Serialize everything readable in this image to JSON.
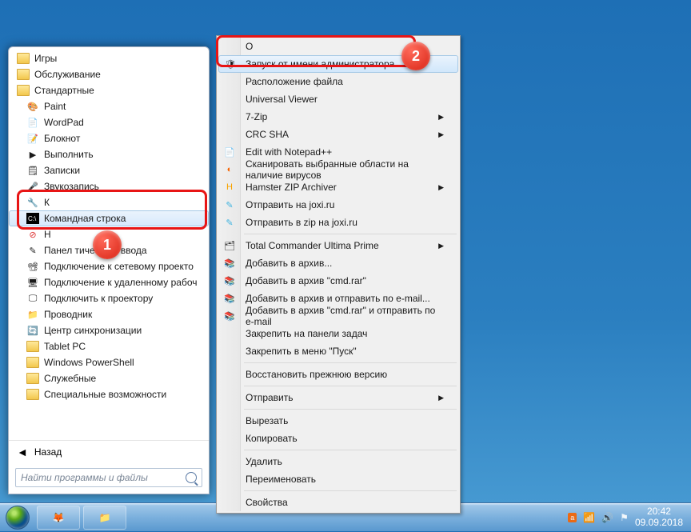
{
  "start_menu": {
    "folders_top": [
      "Игры",
      "Обслуживание",
      "Стандартные"
    ],
    "programs": {
      "paint": "Paint",
      "wordpad": "WordPad",
      "notepad": "Блокнот",
      "run": "Выполнить",
      "notes": "Записки",
      "soundrec": "Звукозапись",
      "cmd_truncated_1": "К",
      "cmd": "Командная строка",
      "cmd_truncated_2": "Н",
      "tablet_input": "Панел           тического ввода",
      "connect_netproj": "Подключение к сетевому проекто",
      "connect_remote": "Подключение к удаленному рабоч",
      "connect_proj": "Подключить к проектору",
      "explorer": "Проводник",
      "sync": "Центр синхронизации"
    },
    "folders_bottom": [
      "Tablet PC",
      "Windows PowerShell",
      "Служебные",
      "Специальные возможности"
    ],
    "back": "Назад",
    "search_placeholder": "Найти программы и файлы"
  },
  "context_menu": {
    "open_truncated": "О",
    "run_as_admin": "Запуск от имени администратора",
    "file_location": "Расположение файла",
    "universal_viewer": "Universal Viewer",
    "seven_zip": "7-Zip",
    "crc_sha": "CRC SHA",
    "notepadpp": "Edit with Notepad++",
    "scan_virus": "Сканировать выбранные области на наличие вирусов",
    "hamster": "Hamster ZIP Archiver",
    "joxi": "Отправить на joxi.ru",
    "joxi_zip": "Отправить в zip на joxi.ru",
    "total_cmd": "Total Commander Ultima Prime",
    "add_archive": "Добавить в архив...",
    "add_cmd_rar": "Добавить в архив \"cmd.rar\"",
    "add_send_email": "Добавить в архив и отправить по e-mail...",
    "add_cmd_send": "Добавить в архив \"cmd.rar\" и отправить по e-mail",
    "pin_taskbar": "Закрепить на панели задач",
    "pin_start": "Закрепить в меню \"Пуск\"",
    "restore_prev": "Восстановить прежнюю версию",
    "send_to": "Отправить",
    "cut": "Вырезать",
    "copy": "Копировать",
    "delete": "Удалить",
    "rename": "Переименовать",
    "properties": "Свойства"
  },
  "tray": {
    "time": "20:42",
    "date": "09.09.2018"
  },
  "badges": {
    "one": "1",
    "two": "2"
  }
}
